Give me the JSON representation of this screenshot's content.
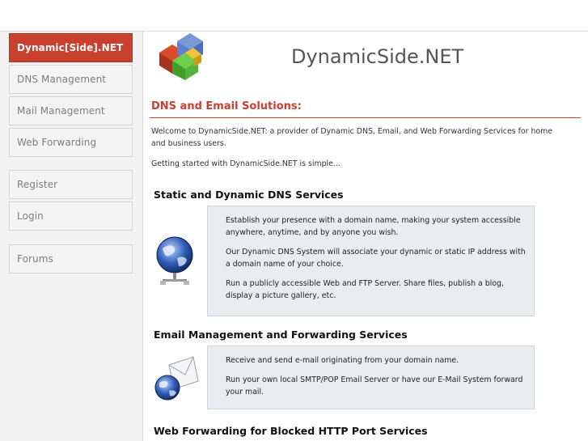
{
  "site": {
    "name": "DynamicSide.NET",
    "tagline": "DNS and Email Solutions:"
  },
  "sidebar": {
    "items": [
      {
        "label": "Dynamic[Side].NET",
        "active": true
      },
      {
        "label": "DNS Management"
      },
      {
        "label": "Mail Management"
      },
      {
        "label": "Web Forwarding"
      },
      {
        "label": "Register"
      },
      {
        "label": "Login"
      },
      {
        "label": "Forums"
      }
    ]
  },
  "intro": {
    "welcome": "Welcome to DynamicSide.NET: a provider of Dynamic DNS, Email, and Web Forwarding Services for home and business users.",
    "getting_started": "Getting started with DynamicSide.NET is simple..."
  },
  "sections": [
    {
      "title": "Static and Dynamic DNS Services",
      "paragraphs": [
        "Establish your presence with a domain name, making your system accessible anywhere, anytime, and by anyone you wish.",
        "Our Dynamic DNS System will associate your dynamic or static IP address with a domain name of your choice.",
        "Run a publicly accessible Web and FTP Server. Share files, publish a blog, display a picture gallery, etc."
      ]
    },
    {
      "title": "Email Management and Forwarding Services",
      "paragraphs": [
        "Receive and send e-mail originating from your domain name.",
        "Run your own local SMTP/POP Email Server or have our E-Mail System forward your mail."
      ]
    },
    {
      "title": "Web Forwarding for Blocked HTTP Port Services"
    }
  ],
  "colors": {
    "accent": "#c9402f",
    "box_bg": "#eaedf0"
  },
  "icons": {
    "logo": "puzzle-cube-logo-icon",
    "dns": "network-globe-icon",
    "email": "email-globe-icon"
  }
}
